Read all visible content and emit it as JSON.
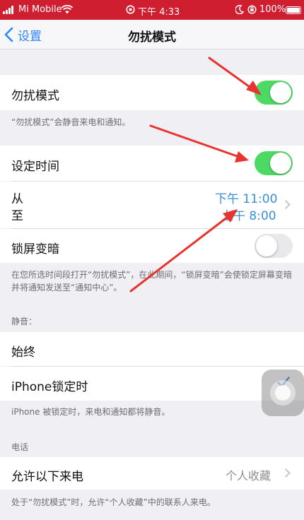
{
  "status_bar": {
    "carrier": "Mi Mobile",
    "time": "下午 4:33",
    "battery": "100%"
  },
  "nav": {
    "back_label": "设置",
    "title": "勿扰模式"
  },
  "dnd": {
    "label": "勿扰模式",
    "enabled": true,
    "footer": "“勿扰模式”会静音来电和通知。"
  },
  "schedule": {
    "label": "设定时间",
    "enabled": true,
    "from_label": "从",
    "to_label": "至",
    "from_time": "下午 11:00",
    "to_time": "上午 8:00"
  },
  "bedtime": {
    "label": "锁屏变暗",
    "enabled": false,
    "footer": "在您所选时间段打开“勿扰模式”，在此期间，“锁屏变暗”会使锁定屏幕变暗并将通知发送至“通知中心”。"
  },
  "silence": {
    "header": "静音：",
    "always_label": "始终",
    "locked_label": "iPhone锁定时",
    "locked_selected": true,
    "footer": "iPhone 被锁定时，来电和通知都将静音。"
  },
  "phone": {
    "header": "电话",
    "allow_calls_label": "允许以下来电",
    "allow_calls_value": "个人收藏",
    "footer": "处于“勿扰模式”时，允许“个人收藏”中的联系人来电。"
  },
  "colors": {
    "status_bar": "#d01e31",
    "toggle_on": "#4cd964",
    "link_blue": "#2c86f7",
    "time_blue": "#3a8fd6",
    "annotation_arrow": "#e8332e"
  },
  "icons": {
    "signal": "signal-bars-icon",
    "wifi": "wifi-icon",
    "alarm": "alarm-icon",
    "moon": "moon-icon",
    "orientation_lock": "orientation-lock-icon",
    "battery": "battery-icon",
    "back": "chevron-left-icon",
    "disclosure": "chevron-right-icon",
    "checkmark": "checkmark-icon",
    "assistive_touch": "assistive-touch-icon"
  }
}
